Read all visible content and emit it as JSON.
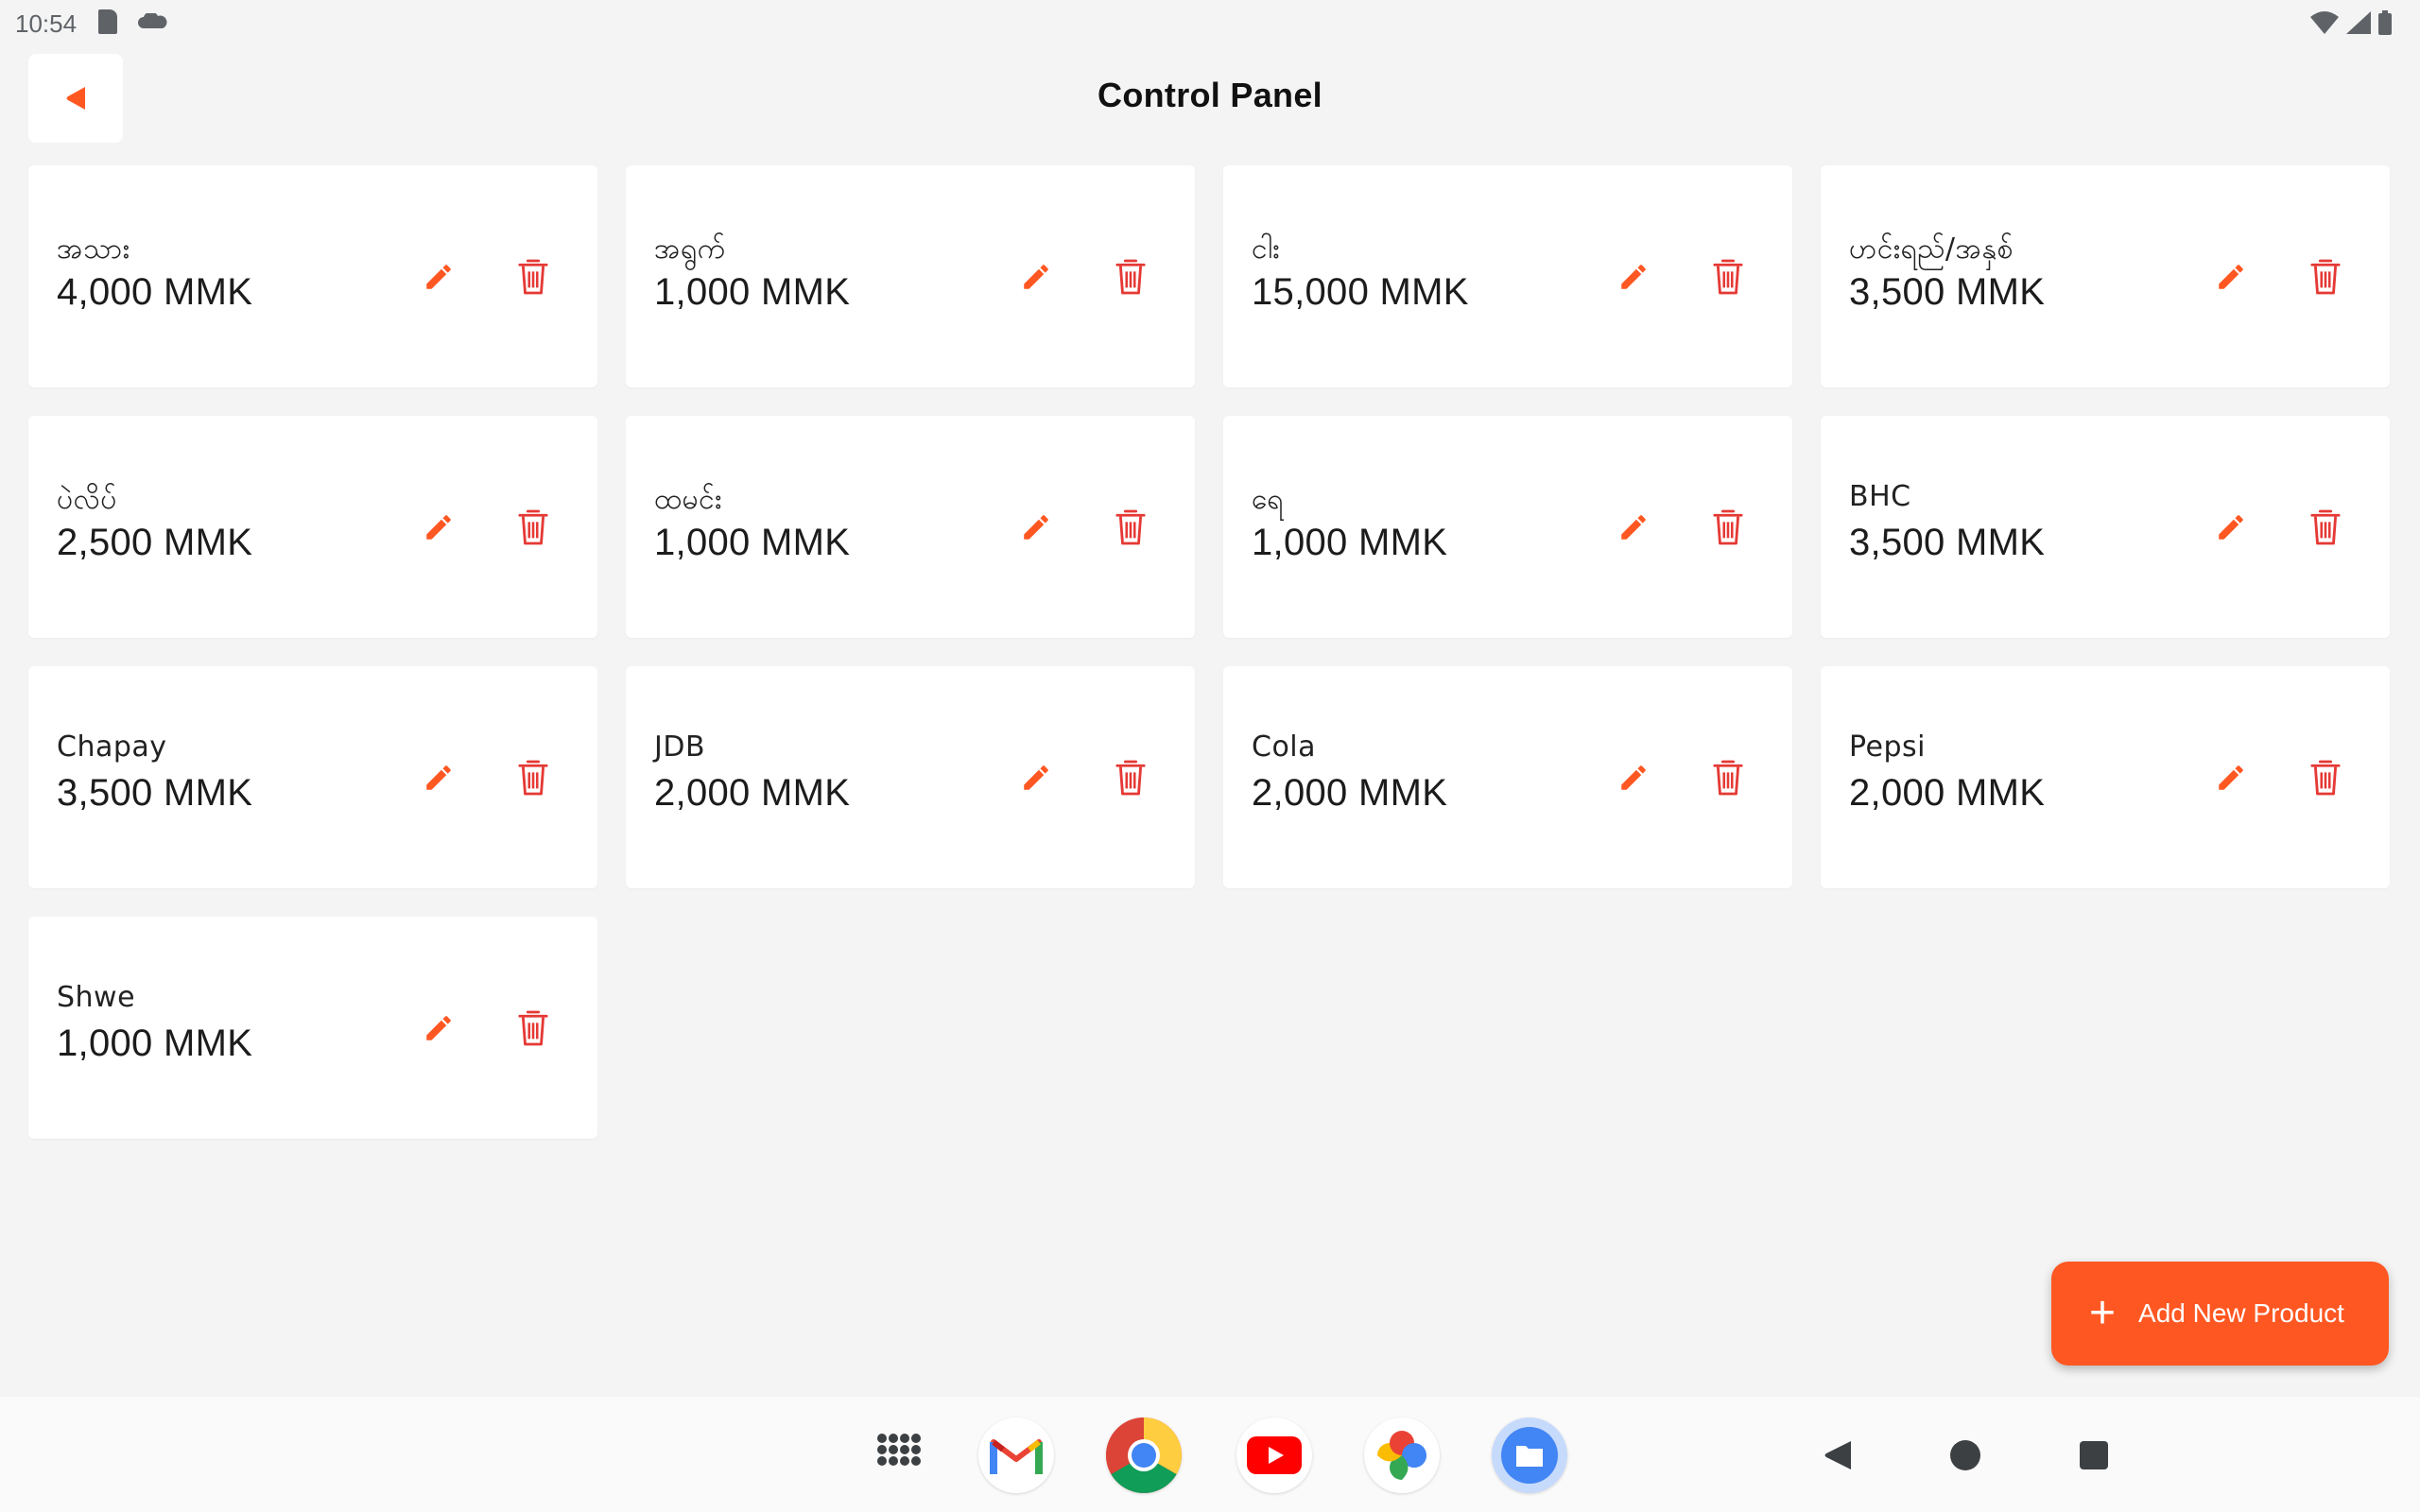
{
  "status_bar": {
    "time": "10:54"
  },
  "header": {
    "title": "Control Panel"
  },
  "products": [
    {
      "name": "အသား",
      "price": "4,000 MMK"
    },
    {
      "name": "အရွက်",
      "price": "1,000 MMK"
    },
    {
      "name": "ငါး",
      "price": "15,000 MMK"
    },
    {
      "name": "ဟင်းရည်/အနှစ်",
      "price": "3,500 MMK"
    },
    {
      "name": "ပဲလိပ်",
      "price": "2,500 MMK"
    },
    {
      "name": "ထမင်း",
      "price": "1,000 MMK"
    },
    {
      "name": "ရေ",
      "price": "1,000 MMK"
    },
    {
      "name": "BHC",
      "price": "3,500 MMK"
    },
    {
      "name": "Chapay",
      "price": "3,500 MMK"
    },
    {
      "name": "JDB",
      "price": "2,000 MMK"
    },
    {
      "name": "Cola",
      "price": "2,000 MMK"
    },
    {
      "name": "Pepsi",
      "price": "2,000 MMK"
    },
    {
      "name": "Shwe",
      "price": "1,000 MMK"
    }
  ],
  "fab": {
    "label": "Add New Product"
  },
  "taskbar": {
    "apps": [
      "app-drawer-icon",
      "gmail-icon",
      "chrome-icon",
      "youtube-icon",
      "photos-icon",
      "files-icon"
    ],
    "nav": [
      "back-nav-icon",
      "home-nav-icon",
      "recents-nav-icon"
    ]
  },
  "colors": {
    "accent": "#ff5722",
    "delete": "#e53935",
    "background": "#f4f4f4",
    "card": "#ffffff"
  }
}
